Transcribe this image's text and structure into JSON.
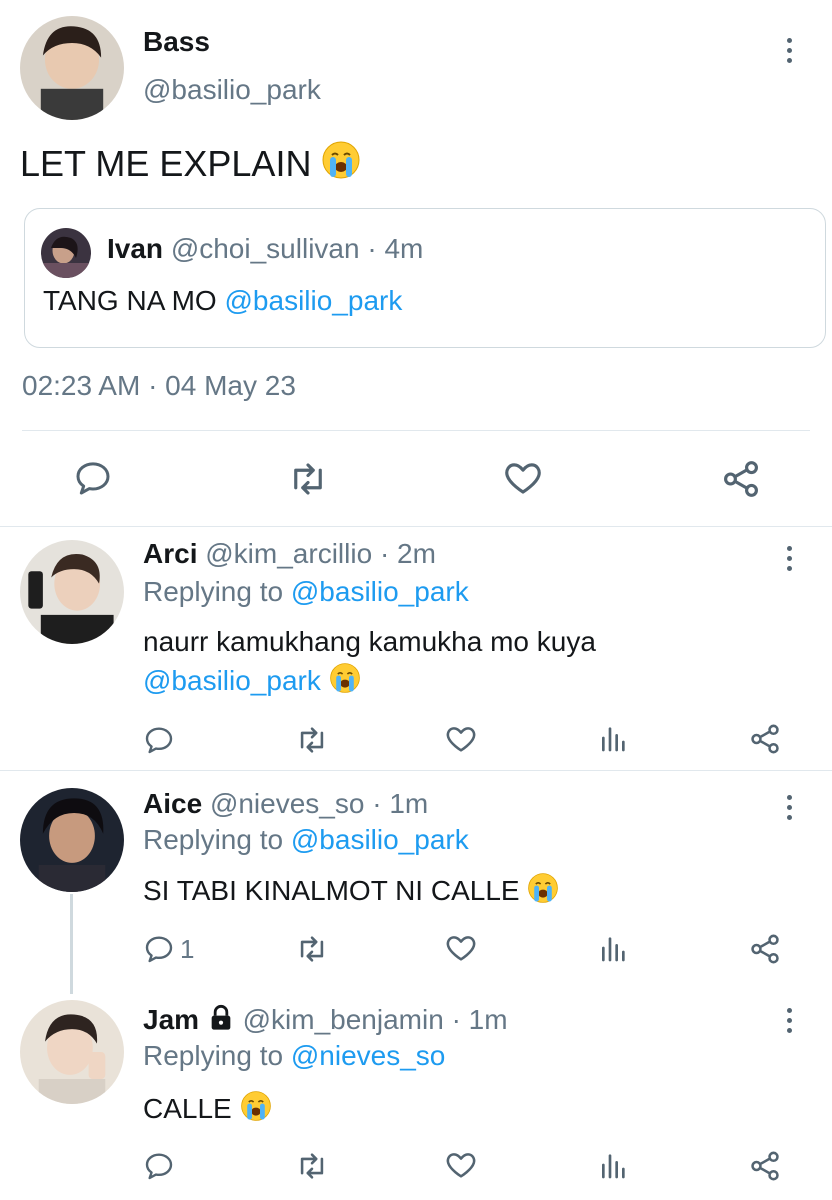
{
  "main_tweet": {
    "author_name": "Bass",
    "author_handle": "@basilio_park",
    "text": "LET ME EXPLAIN",
    "emoji": "loudly-crying-face",
    "quoted": {
      "author_name": "Ivan",
      "author_handle": "@choi_sullivan",
      "time": "· 4m",
      "text": "TANG NA MO",
      "mention": "@basilio_park"
    },
    "timestamp": "02:23 AM · 04 May 23",
    "actions": [
      "reply-icon",
      "retweet-icon",
      "like-icon",
      "share-icon"
    ]
  },
  "replies": [
    {
      "author_name": "Arci",
      "author_handle": "@kim_arcillio",
      "time": "· 2m",
      "replying_to_label": "Replying to",
      "replying_to_handle": "@basilio_park",
      "text": "naurr kamukhang kamukha mo kuya",
      "mention": "@basilio_park",
      "reply_count": ""
    },
    {
      "author_name": "Aice",
      "author_handle": "@nieves_so",
      "time": "· 1m",
      "replying_to_label": "Replying to",
      "replying_to_handle": "@basilio_park",
      "text": "SI TABI KINALMOT NI CALLE",
      "reply_count": "1"
    },
    {
      "author_name": "Jam",
      "author_handle": "@kim_benjamin",
      "time": "· 1m",
      "locked": true,
      "replying_to_label": "Replying to",
      "replying_to_handle": "@nieves_so",
      "text": "CALLE",
      "reply_count": ""
    }
  ],
  "colors": {
    "link": "#1d9bf0",
    "muted": "#657786",
    "divider": "#e1e8ed",
    "icon": "#536471"
  }
}
